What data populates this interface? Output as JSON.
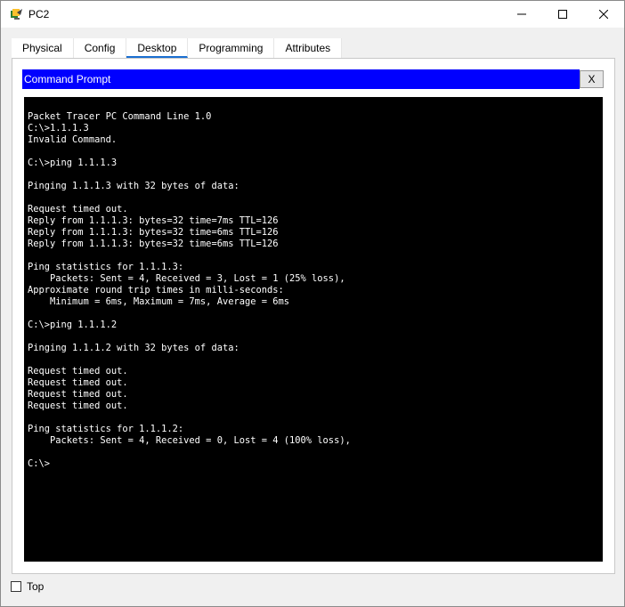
{
  "window": {
    "title": "PC2",
    "controls": [
      "minimize-icon",
      "maximize-icon",
      "close-icon"
    ]
  },
  "tabs": [
    {
      "label": "Physical",
      "active": false
    },
    {
      "label": "Config",
      "active": false
    },
    {
      "label": "Desktop",
      "active": true
    },
    {
      "label": "Programming",
      "active": false
    },
    {
      "label": "Attributes",
      "active": false
    }
  ],
  "command_prompt": {
    "title": "Command Prompt",
    "close_label": "X",
    "lines": [
      "Packet Tracer PC Command Line 1.0",
      "C:\\>1.1.1.3",
      "Invalid Command.",
      "",
      "C:\\>ping 1.1.1.3",
      "",
      "Pinging 1.1.1.3 with 32 bytes of data:",
      "",
      "Request timed out.",
      "Reply from 1.1.1.3: bytes=32 time=7ms TTL=126",
      "Reply from 1.1.1.3: bytes=32 time=6ms TTL=126",
      "Reply from 1.1.1.3: bytes=32 time=6ms TTL=126",
      "",
      "Ping statistics for 1.1.1.3:",
      "    Packets: Sent = 4, Received = 3, Lost = 1 (25% loss),",
      "Approximate round trip times in milli-seconds:",
      "    Minimum = 6ms, Maximum = 7ms, Average = 6ms",
      "",
      "C:\\>ping 1.1.1.2",
      "",
      "Pinging 1.1.1.2 with 32 bytes of data:",
      "",
      "Request timed out.",
      "Request timed out.",
      "Request timed out.",
      "Request timed out.",
      "",
      "Ping statistics for 1.1.1.2:",
      "    Packets: Sent = 4, Received = 0, Lost = 4 (100% loss),",
      "",
      "C:\\>"
    ]
  },
  "footer": {
    "top_label": "Top",
    "top_checked": false
  },
  "colors": {
    "cmd_title_bg": "#0000ff",
    "terminal_bg": "#000000",
    "terminal_fg": "#ffffff",
    "active_tab_underline": "#1a6fd1"
  }
}
